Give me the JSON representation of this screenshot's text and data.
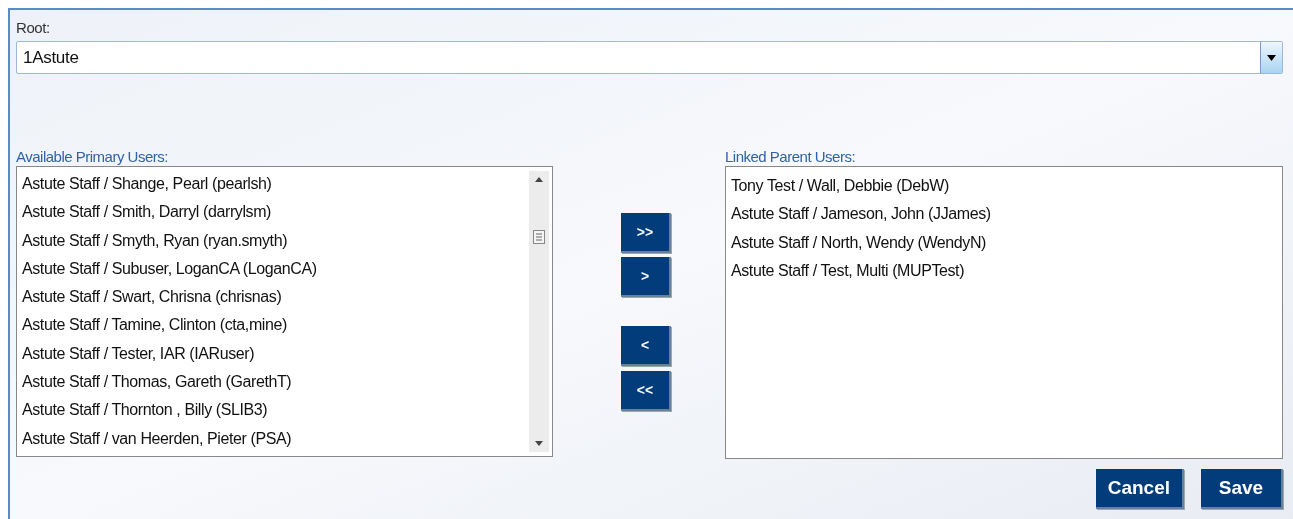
{
  "root": {
    "label": "Root:",
    "value": "1Astute"
  },
  "available": {
    "label": "Available Primary Users:",
    "items": [
      {
        "text": "Astute Staff / Shange, Pearl (pearlsh)"
      },
      {
        "text": "Astute Staff / Smith, Darryl (darrylsm)"
      },
      {
        "text": "Astute Staff / Smyth, Ryan (ryan.smyth)"
      },
      {
        "text": "Astute Staff / Subuser, LoganCA (LoganCA)"
      },
      {
        "text": "Astute Staff / Swart, Chrisna (chrisnas)"
      },
      {
        "text": "Astute Staff / Tamine, Clinton (cta,mine)"
      },
      {
        "text": "Astute Staff / Tester, IAR (IARuser)"
      },
      {
        "text": "Astute Staff / Thomas, Gareth (GarethT)"
      },
      {
        "text": "Astute Staff / Thornton , Billy (SLIB3)"
      },
      {
        "text": "Astute Staff / van Heerden, Pieter (PSA)"
      }
    ]
  },
  "move_buttons": [
    {
      "label": ">>"
    },
    {
      "label": ">"
    },
    {
      "label": "<"
    },
    {
      "label": "<<"
    }
  ],
  "linked": {
    "label": "Linked Parent Users:",
    "items": [
      {
        "text": "Tony Test / Wall, Debbie (DebW)"
      },
      {
        "text": "Astute Staff / Jameson, John (JJames)"
      },
      {
        "text": "Astute Staff / North, Wendy (WendyN)"
      },
      {
        "text": "Astute Staff / Test, Multi (MUPTest)"
      }
    ]
  },
  "actions": [
    {
      "label": "Cancel"
    },
    {
      "label": "Save"
    }
  ]
}
